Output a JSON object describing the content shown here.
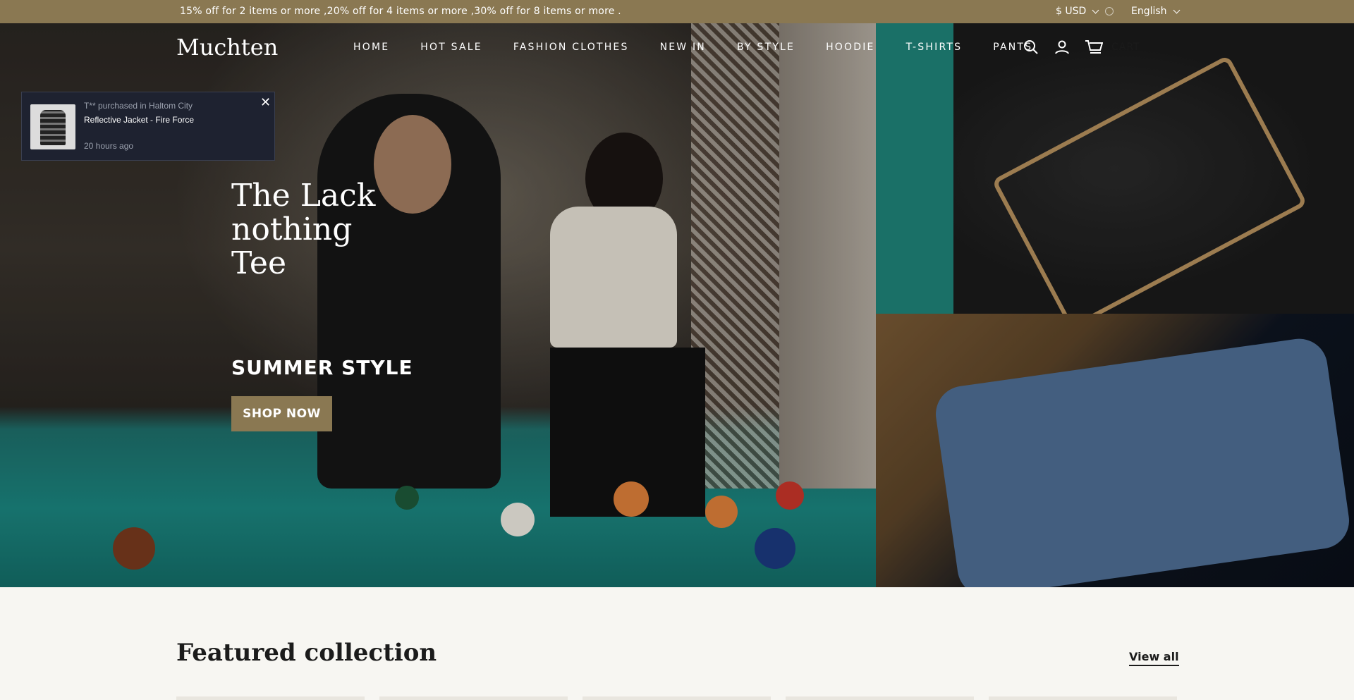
{
  "announcement": {
    "text": "15% off for 2 items or more ,20% off for 4 items or more ,30% off for 8 items or more .",
    "currency": "$ USD",
    "language": "English"
  },
  "header": {
    "logo": "Muchten",
    "nav": [
      "HOME",
      "HOT SALE",
      "FASHION CLOTHES",
      "NEW IN",
      "BY STYLE",
      "HOODIE",
      "T-SHIRTS",
      "PANTS"
    ],
    "cart_label": "CART"
  },
  "popup": {
    "line1": "T** purchased in Haltom City",
    "line2": "Reflective Jacket - Fire Force",
    "line3": "20 hours ago",
    "close": "✕"
  },
  "hero": {
    "title": "The Lack nothing Tee",
    "subtitle": "SUMMER STYLE",
    "button": "SHOP NOW"
  },
  "featured": {
    "title": "Featured collection",
    "view_all": "View all"
  },
  "colors": {
    "accent": "#8a7852",
    "popup_bg": "#1e2230",
    "page_bg": "#f7f6f2"
  },
  "icons": [
    "search-icon",
    "account-icon",
    "cart-icon",
    "close-icon",
    "chevron-down-icon"
  ]
}
